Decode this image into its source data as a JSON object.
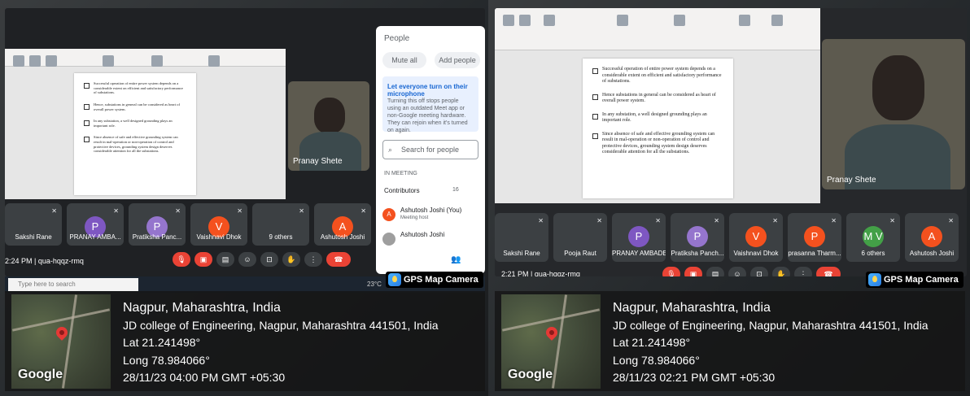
{
  "left": {
    "document": {
      "bullets": [
        "Successful operation of entire power system depends on a considerable extent on efficient and satisfactory performance of substations.",
        "Hence, substations in general can be considered as heart of overall power system.",
        "In any substation, a well designed grounding plays an important role.",
        "Since absence of safe and effective grounding system can result in mal-operation or non-operation of control and protective devices, grounding system design deserves considerable attention for all the substations."
      ]
    },
    "speaker_name": "Pranay Shete",
    "participants": [
      {
        "initial": "",
        "name": "Sakshi Rane",
        "color": "#6a5a4a"
      },
      {
        "initial": "P",
        "name": "PRANAY AMBA...",
        "color": "#7e57c2"
      },
      {
        "initial": "P",
        "name": "Pratiksha Panc...",
        "color": "#9575cd"
      },
      {
        "initial": "V",
        "name": "Vaishnavi Dhok",
        "color": "#f4511e"
      },
      {
        "initial": "",
        "name": "9 others",
        "color": "#e8710a"
      },
      {
        "initial": "A",
        "name": "Ashutosh Joshi",
        "color": "#f4511e"
      }
    ],
    "meeting_time": "2:24 PM",
    "meeting_code": "qua-hqqz-rmq",
    "people_panel": {
      "title": "People",
      "mute_all": "Mute all",
      "add_people": "Add people",
      "toggle_title": "Let everyone turn on their microphone",
      "toggle_desc": "Turning this off stops people using an outdated Meet app or non-Google meeting hardware. They can rejoin when it's turned on again.",
      "search_placeholder": "Search for people",
      "in_meeting": "IN MEETING",
      "contributors": "Contributors",
      "contributors_count": "16",
      "rows": [
        {
          "initial": "A",
          "name": "Ashutosh Joshi (You)",
          "sub": "Meeting host"
        },
        {
          "initial": "",
          "name": "Ashutosh Joshi",
          "sub": ""
        }
      ]
    },
    "taskbar": {
      "search": "Type here to search",
      "temp": "23°C"
    },
    "gps_badge": "GPS Map Camera",
    "location": {
      "city": "Nagpur, Maharashtra, India",
      "address": "JD college of Engineering, Nagpur, Maharashtra 441501, India",
      "lat": "Lat 21.241498°",
      "long": "Long 78.984066°",
      "datetime": "28/11/23 04:00 PM GMT +05:30",
      "map_brand": "Google"
    }
  },
  "right": {
    "document": {
      "bullets": [
        "Successful operation of entire power system depends on a considerable extent on efficient and satisfactory performance of substations.",
        "Hence substations in general can be considered as heart of overall power system.",
        "In any substation, a well designed grounding plays an important role.",
        "Since absence of safe and effective grounding system can result in mal-operation or non-operation of control and protective devices, grounding system design deserves considerable attention for all the substations."
      ]
    },
    "speaker_name": "Pranay Shete",
    "participants": [
      {
        "initial": "",
        "name": "Sakshi Rane",
        "color": "#6a5a4a"
      },
      {
        "initial": "",
        "name": "Pooja Raut",
        "color": "#3c4043"
      },
      {
        "initial": "P",
        "name": "PRANAY AMBADE",
        "color": "#7e57c2"
      },
      {
        "initial": "P",
        "name": "Pratiksha Panch...",
        "color": "#9575cd"
      },
      {
        "initial": "V",
        "name": "Vaishnavi Dhok",
        "color": "#f4511e"
      },
      {
        "initial": "P",
        "name": "prasanna Tharm...",
        "color": "#f4511e"
      },
      {
        "initial": "M V",
        "name": "6 others",
        "color": "#43a047"
      },
      {
        "initial": "A",
        "name": "Ashutosh Joshi",
        "color": "#f4511e"
      }
    ],
    "meeting_time": "2:21 PM",
    "meeting_code": "qua-hqqz-rmq",
    "gps_badge": "GPS Map Camera",
    "location": {
      "city": "Nagpur, Maharashtra, India",
      "address": "JD college of Engineering, Nagpur, Maharashtra 441501, India",
      "lat": "Lat 21.241498°",
      "long": "Long 78.984066°",
      "datetime": "28/11/23 02:21 PM GMT +05:30",
      "map_brand": "Google"
    }
  }
}
